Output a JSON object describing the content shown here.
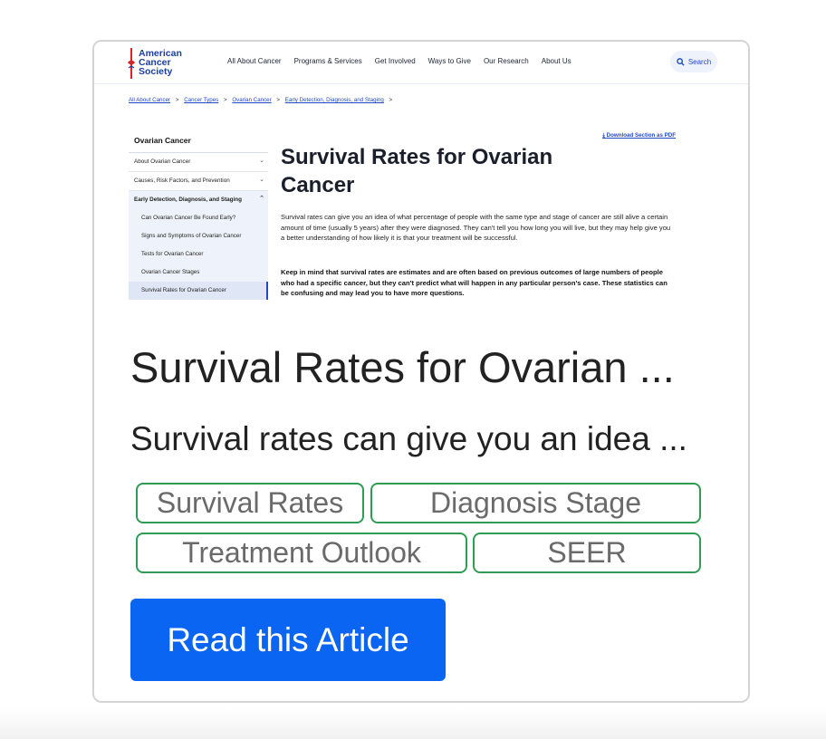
{
  "preview": {
    "logo": {
      "line1": "American",
      "line2": "Cancer",
      "line3": "Society"
    },
    "nav": [
      "All About Cancer",
      "Programs & Services",
      "Get Involved",
      "Ways to Give",
      "Our Research",
      "About Us"
    ],
    "search_label": "Search",
    "breadcrumb": [
      "All About Cancer",
      "Cancer Types",
      "Ovarian Cancer",
      "Early Detection, Diagnosis, and Staging"
    ],
    "breadcrumb_separator": ">",
    "sidebar": {
      "title": "Ovarian Cancer",
      "items": [
        "About Ovarian Cancer",
        "Causes, Risk Factors, and Prevention"
      ],
      "expanded_item": "Early Detection, Diagnosis, and Staging",
      "subitems": [
        "Can Ovarian Cancer Be Found Early?",
        "Signs and Symptoms of Ovarian Cancer",
        "Tests for Ovarian Cancer",
        "Ovarian Cancer Stages",
        "Survival Rates for Ovarian Cancer"
      ]
    },
    "download_label": "Download Section as PDF",
    "article_title": "Survival Rates for Ovarian Cancer",
    "paragraph": "Survival rates can give you an idea of what percentage of people with the same type and stage of cancer are still alive a certain amount of time (usually 5 years) after they were diagnosed. They can't tell you how long you will live, but they may help give you a better understanding of how likely it is that your treatment will be successful.",
    "paragraph_bold": "Keep in mind that survival rates are estimates and are often based on previous outcomes of large numbers of people who had a specific cancer, but they can't predict what will happen in any particular person's case. These statistics can be confusing and may lead you to have more questions."
  },
  "card": {
    "headline": "Survival Rates for Ovarian ...",
    "summary": "Survival rates can give you an idea ...",
    "tags": [
      "Survival Rates",
      "Diagnosis Stage",
      "Treatment Outlook",
      "SEER"
    ],
    "button_label": "Read this Article"
  },
  "colors": {
    "tag_border": "#2f9c55",
    "button_bg": "#0a66f2",
    "acs_blue": "#1b3fa0",
    "acs_red": "#d8232a"
  }
}
